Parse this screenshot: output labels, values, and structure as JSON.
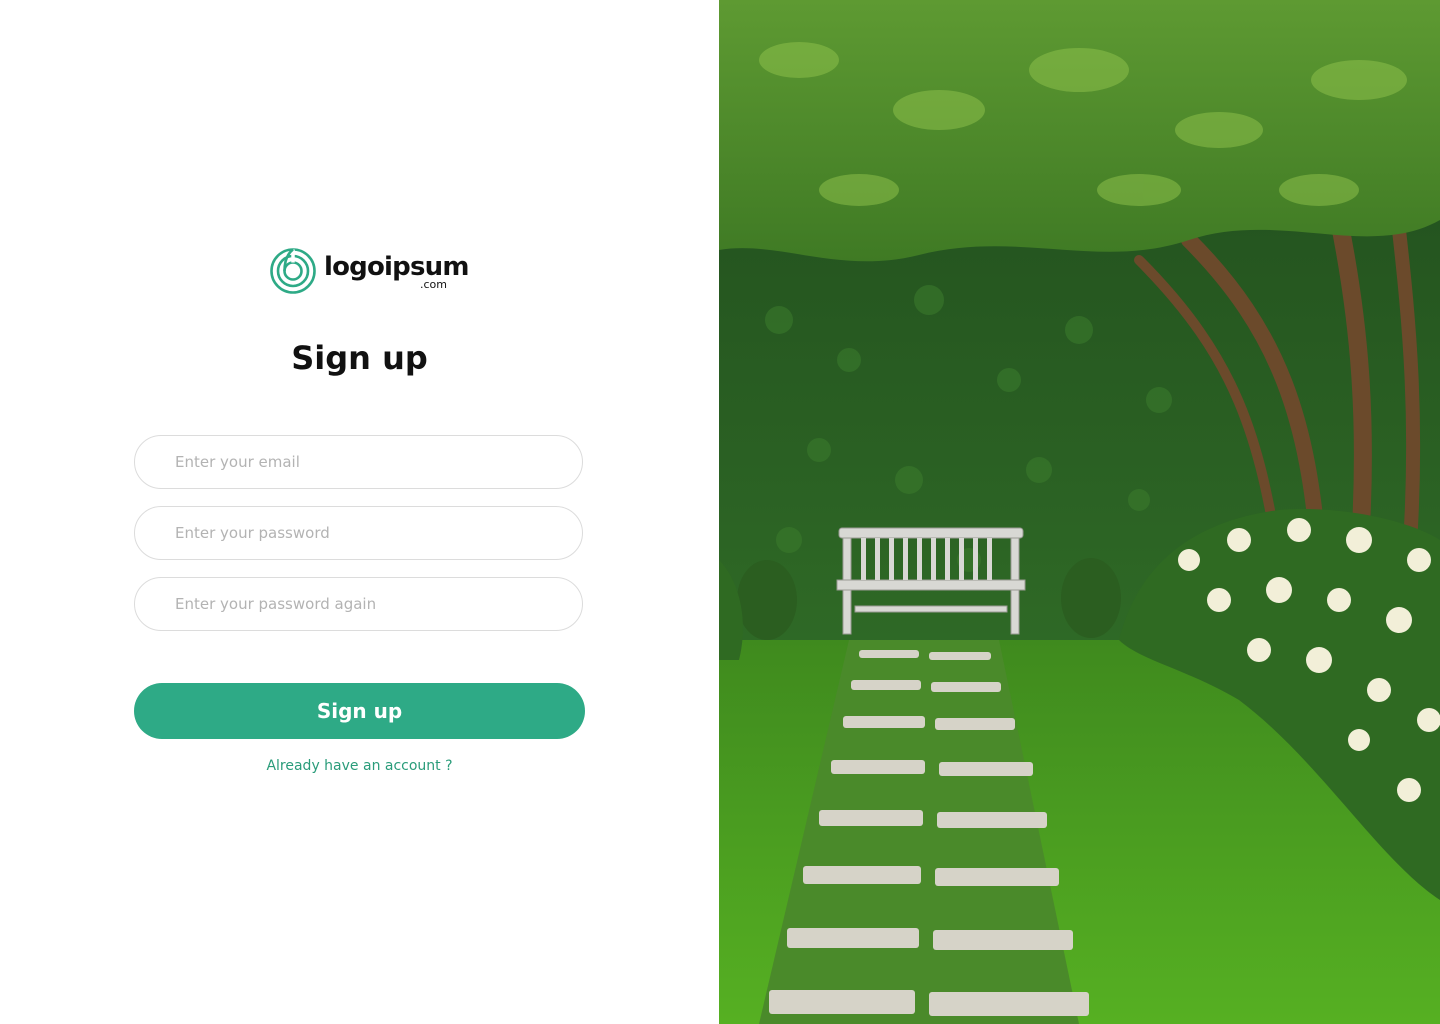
{
  "brand": {
    "name": "logoipsum",
    "tld": ".com"
  },
  "form": {
    "title": "Sign up",
    "email_placeholder": "Enter your email",
    "password_placeholder": "Enter your password",
    "password_again_placeholder": "Enter your password again",
    "submit_label": "Sign up",
    "signin_link": "Already have an account ?"
  },
  "theme": {
    "accent": "#2eaa86",
    "link": "#2a9c7a"
  },
  "hero": {
    "subject": "garden with bench, stone path and hedge"
  }
}
